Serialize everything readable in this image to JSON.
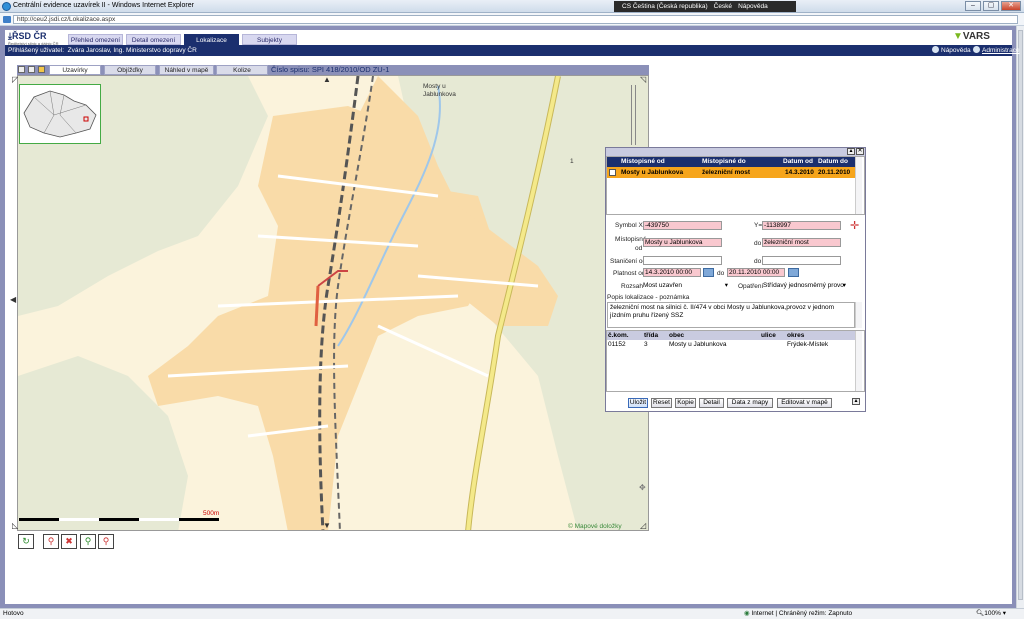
{
  "window": {
    "title": "Centrální evidence uzavírek II - Windows Internet Explorer",
    "url": "http://ceu2.jsdi.cz/Lokalizace.aspx",
    "lang_bar": [
      "CS Čeština (Česká republika)",
      "České",
      "Nápověda"
    ]
  },
  "header": {
    "logo": "ŘSD ČR",
    "logo_sub": "Ředitelství silnic a dálnic ČR",
    "tabs": [
      {
        "label": "Přehled omezení",
        "active": false
      },
      {
        "label": "Detail omezení",
        "active": false
      },
      {
        "label": "Lokalizace",
        "active": true
      },
      {
        "label": "Subjekty",
        "active": false
      }
    ],
    "brand": "VARS"
  },
  "userbar": {
    "user_label": "Přihlášený uživatel:",
    "user_value": "Zvára Jaroslav, Ing. Ministerstvo dopravy ČR",
    "help": "Nápověda",
    "admin": "Administrace"
  },
  "map_toolbar": {
    "tabs": [
      "Uzavírky",
      "Objížďky",
      "Náhled v mapě",
      "Kolize"
    ],
    "active_tab": "Uzavírky",
    "spis": "Číslo spisu: SPI 418/2010/OD ZU-1"
  },
  "map": {
    "place_label": "Mosty u\nJablunkova",
    "road_label_1": "1",
    "scale_label": "500m",
    "credit": "© Mapové doložky",
    "colors": {
      "background": "#fbf3dc",
      "forest": "#e6e9d4",
      "builtup": "#f9dba8",
      "road_main": "#f4e98a",
      "rail": "#555555",
      "water": "#9fc7ea"
    }
  },
  "panel": {
    "list_headers": [
      "Místopisné od",
      "Místopisné do",
      "Datum od",
      "Datum do"
    ],
    "list_rows": [
      {
        "od": "Mosty u Jablunkova",
        "do": "železniční most",
        "datum_od": "14.3.2010",
        "datum_do": "20.11.2010"
      }
    ],
    "form": {
      "symbol_x_label": "Symbol X=",
      "symbol_x": "-439750",
      "y_label": "Y=",
      "y": "-1138997",
      "mistopisne_label": "Místopisné",
      "od_label": "od",
      "mistopisne_od": "Mosty u Jablunkova",
      "do_label": "do",
      "mistopisne_do": "železniční most",
      "staniceni_label": "Staničení od",
      "staniceni_od": "",
      "staniceni_do": "",
      "platnost_label": "Platnost od",
      "platnost_od": "14.3.2010 00:00",
      "platnost_do": "20.11.2010 00:00",
      "rozsah_label": "Rozsah",
      "rozsah": "Most uzavřen",
      "opatreni_label": "Opatření",
      "opatreni": "Střídavý jednosměrný provo"
    },
    "note_label": "Popis lokalizace - poznámka",
    "note": "železniční most na silnici č. II/474 v obci Mosty u Jablunkova,provoz v jednom jízdním pruhu řízený SSZ",
    "obec_headers": [
      "č.kom.",
      "třída",
      "obec",
      "ulice",
      "okres"
    ],
    "obec_rows": [
      {
        "kom": "01152",
        "trida": "3",
        "obec": "Mosty u Jablunkova",
        "ulice": "",
        "okres": "Frýdek-Místek"
      }
    ],
    "buttons": [
      "Uložit",
      "Reset",
      "Kopie",
      "Detail",
      "Data z mapy",
      "Editovat v mapě"
    ]
  },
  "status": {
    "left": "Hotovo",
    "zone": "Internet | Chráněný režim: Zapnuto",
    "zoom": "100%"
  }
}
